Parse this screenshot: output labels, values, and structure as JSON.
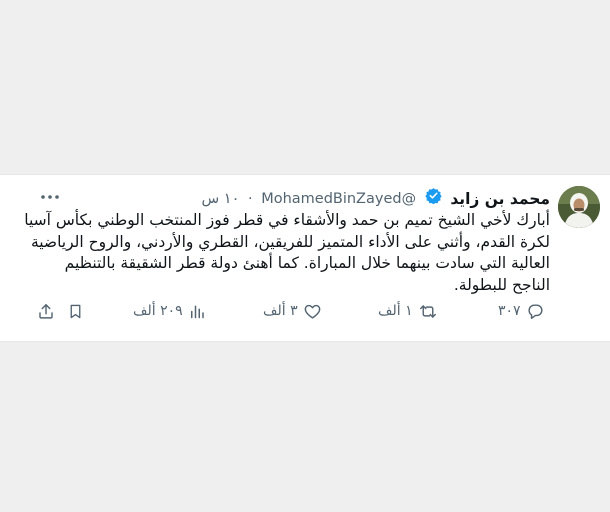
{
  "tweet": {
    "display_name": "محمد بن زايد",
    "handle": "@MohamedBinZayed",
    "separator": "·",
    "time": "١٠ س",
    "body_lines": [
      "أبارك لأخي الشيخ تميم بن حمد والأشقاء في قطر فوز المنتخب الوطني بكأس آسيا",
      "لكرة القدم، وأثني على الأداء المتميز للفريقين، القطري والأردني، والروح الرياضية",
      "العالية التي سادت بينهما خلال المباراة. كما أهنئ دولة قطر الشقيقة بالتنظيم",
      "الناجح للبطولة."
    ],
    "actions": {
      "replies": "٣٠٧",
      "retweets": "١ ألف",
      "likes": "٣ ألف",
      "views": "٢٠٩ ألف"
    }
  },
  "icons": {
    "verified": "verified-badge-icon",
    "more": "more-dots-icon",
    "reply": "reply-icon",
    "retweet": "retweet-icon",
    "like": "heart-icon",
    "views": "views-icon",
    "bookmark": "bookmark-icon",
    "share": "share-icon"
  },
  "colors": {
    "verified": "#1d9bf0",
    "secondary_text": "#536471",
    "text": "#0f1419"
  }
}
